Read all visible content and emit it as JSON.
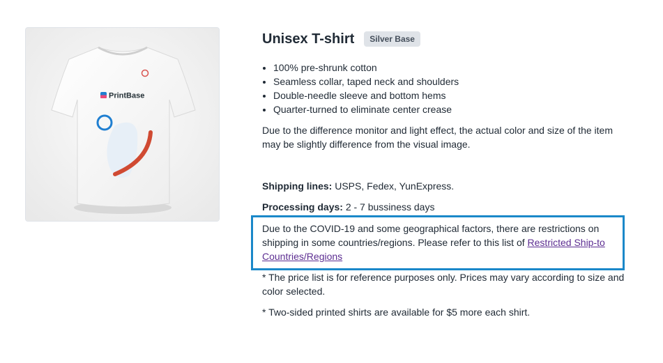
{
  "product": {
    "title": "Unisex T-shirt",
    "badge": "Silver Base",
    "brand_logo_text": "PrintBase",
    "features": [
      "100% pre-shrunk cotton",
      "Seamless collar, taped neck and shoulders",
      "Double-needle sleeve and bottom hems",
      "Quarter-turned to eliminate center crease"
    ],
    "disclaimer": "Due to the difference monitor and light effect, the actual color and size of the item may be slightly difference from the visual image."
  },
  "shipping": {
    "lines_label": "Shipping lines:",
    "lines_value": " USPS, Fedex, YunExpress.",
    "processing_label": "Processing days:",
    "processing_value": " 2 - 7 bussiness days"
  },
  "covid_notice": {
    "text": "Due to the COVID-19 and some geographical factors, there are restrictions on shipping in some countries/regions. Please refer to this list of ",
    "link_text": "Restricted Ship-to Countries/Regions",
    "highlight_color": "#1a88c9"
  },
  "notes": {
    "price_note": "* The price list is for reference purposes only. Prices may vary according to size and color selected.",
    "two_sided_note": "* Two-sided printed shirts are available for $5 more each shirt."
  },
  "icons": {
    "brand_logo": "printbase-logo-icon"
  }
}
